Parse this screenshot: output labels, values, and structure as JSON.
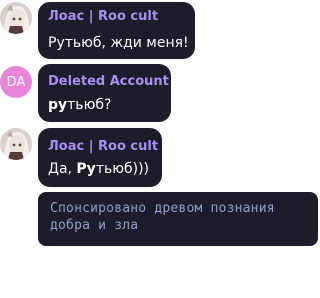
{
  "colors": {
    "bubble_bg": "#1c1c2a",
    "sender_name": "#a98ff0",
    "message_text": "#ffffff",
    "avatar_deleted_bg": "#e985d8",
    "sponsored_text": "#8f9fcc"
  },
  "messages": [
    {
      "sender": "Лоас | Roo cult",
      "avatar": "anime-girl-avatar",
      "text_parts": [
        "Рутьюб, жди меня!"
      ]
    },
    {
      "sender": "Deleted Account",
      "avatar_initials": "DA",
      "text_parts": [
        "ру",
        "тьюб?"
      ]
    },
    {
      "sender": "Лоас | Roo cult",
      "avatar": "anime-girl-avatar",
      "text_parts": [
        "Да, ",
        "Ру",
        "тьюб)))"
      ]
    }
  ],
  "sponsored": {
    "lines": [
      "Спонсировано древом познания",
      "добра и зла"
    ]
  }
}
